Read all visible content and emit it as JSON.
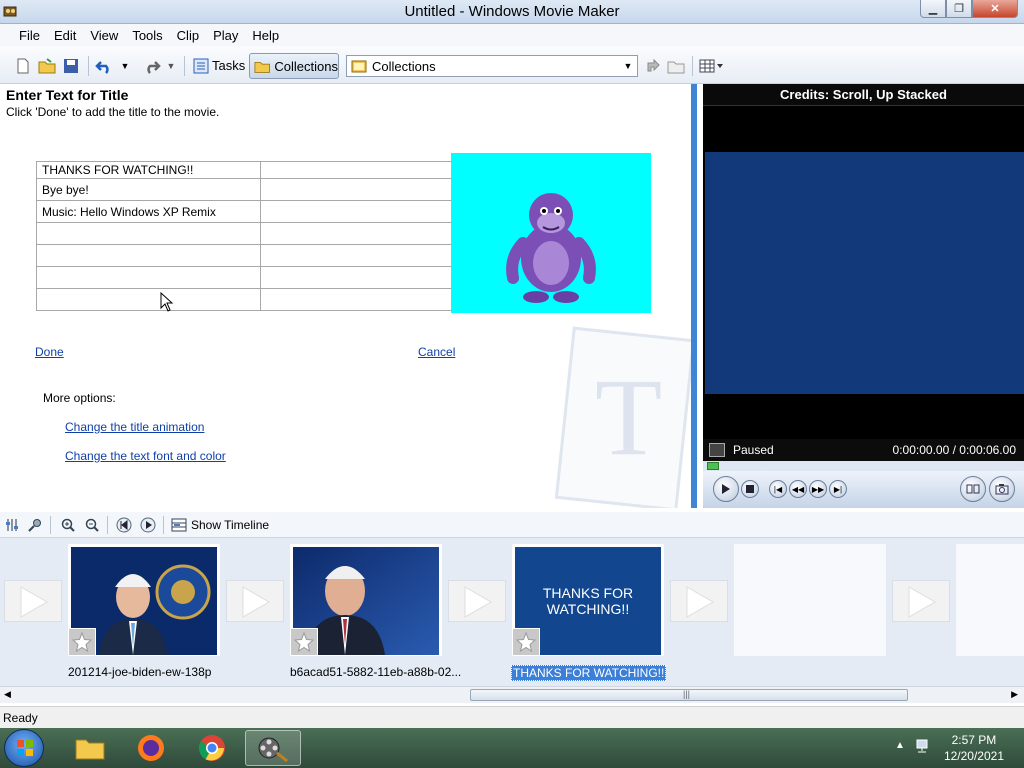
{
  "window": {
    "title": "Untitled - Windows Movie Maker"
  },
  "menu": [
    "File",
    "Edit",
    "View",
    "Tools",
    "Clip",
    "Play",
    "Help"
  ],
  "toolbar": {
    "tasks_label": "Tasks",
    "collections_label": "Collections",
    "collections_select_value": "Collections"
  },
  "taskpane": {
    "heading": "Enter Text for Title",
    "subheading": "Click 'Done' to add the title to the movie.",
    "table_rows": [
      [
        "THANKS FOR WATCHING!!",
        ""
      ],
      [
        "Bye bye!",
        ""
      ],
      [
        "Music: Hello Windows XP Remix",
        ""
      ],
      [
        "",
        ""
      ],
      [
        "",
        ""
      ],
      [
        "",
        ""
      ],
      [
        "",
        ""
      ]
    ],
    "done_link": "Done",
    "cancel_link": "Cancel",
    "more_options": "More options:",
    "change_animation_link": "Change the title animation",
    "change_font_link": "Change the text font and color",
    "preview_bg_color": "#00ffff"
  },
  "monitor": {
    "title": "Credits: Scroll, Up Stacked",
    "status": "Paused",
    "time": "0:00:00.00 / 0:00:06.00",
    "progress": 0
  },
  "storyboard": {
    "show_timeline_label": "Show Timeline",
    "clips": [
      {
        "label": "201214-joe-biden-ew-138p",
        "selected": false
      },
      {
        "label": "b6acad51-5882-11eb-a88b-02...",
        "selected": false
      },
      {
        "label": "THANKS FOR WATCHING!!",
        "selected": true,
        "thumb_text": "THANKS FOR WATCHING!!"
      }
    ]
  },
  "status_bar": {
    "text": "Ready"
  },
  "taskbar": {
    "time": "2:57 PM",
    "date": "12/20/2021",
    "apps": [
      "file-explorer",
      "firefox",
      "chrome",
      "movie-maker"
    ]
  }
}
